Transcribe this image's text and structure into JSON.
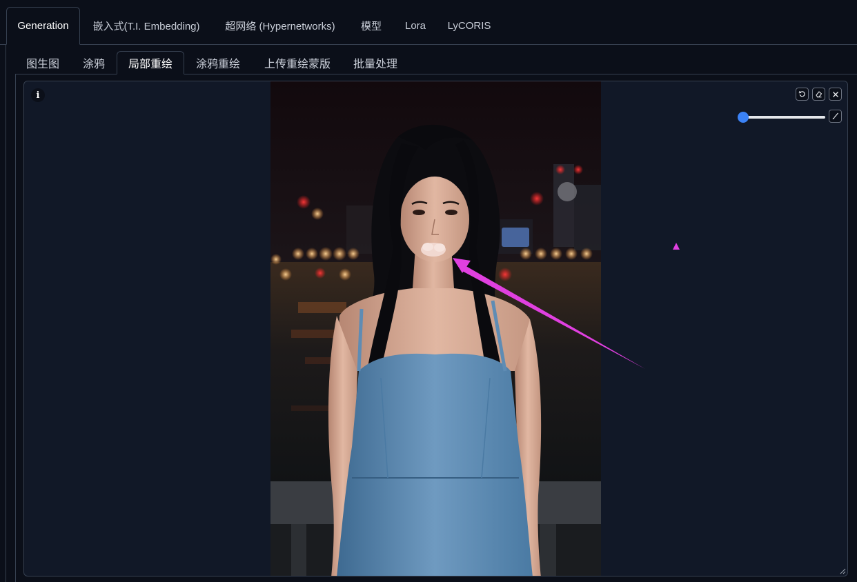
{
  "top_tabs": [
    {
      "label": "Generation",
      "active": true
    },
    {
      "label": "嵌入式(T.I. Embedding)",
      "active": false
    },
    {
      "label": "超网络 (Hypernetworks)",
      "active": false
    },
    {
      "label": "模型",
      "active": false
    },
    {
      "label": "Lora",
      "active": false
    },
    {
      "label": "LyCORIS",
      "active": false
    }
  ],
  "sub_tabs": [
    {
      "label": "图生图",
      "active": false
    },
    {
      "label": "涂鸦",
      "active": false
    },
    {
      "label": "局部重绘",
      "active": true
    },
    {
      "label": "涂鸦重绘",
      "active": false
    },
    {
      "label": "上传重绘蒙版",
      "active": false
    },
    {
      "label": "批量处理",
      "active": false
    }
  ],
  "editor": {
    "info_label": "i",
    "undo_icon": "undo-icon",
    "clear_icon": "eraser-icon",
    "close_icon": "close-icon",
    "brush_icon": "brush-icon",
    "brush_size_fraction": 0.06
  },
  "colors": {
    "background": "#0b0f19",
    "panel": "#111827",
    "border": "#374151",
    "accent": "#3b82f6",
    "annotation": "#e040e0"
  }
}
